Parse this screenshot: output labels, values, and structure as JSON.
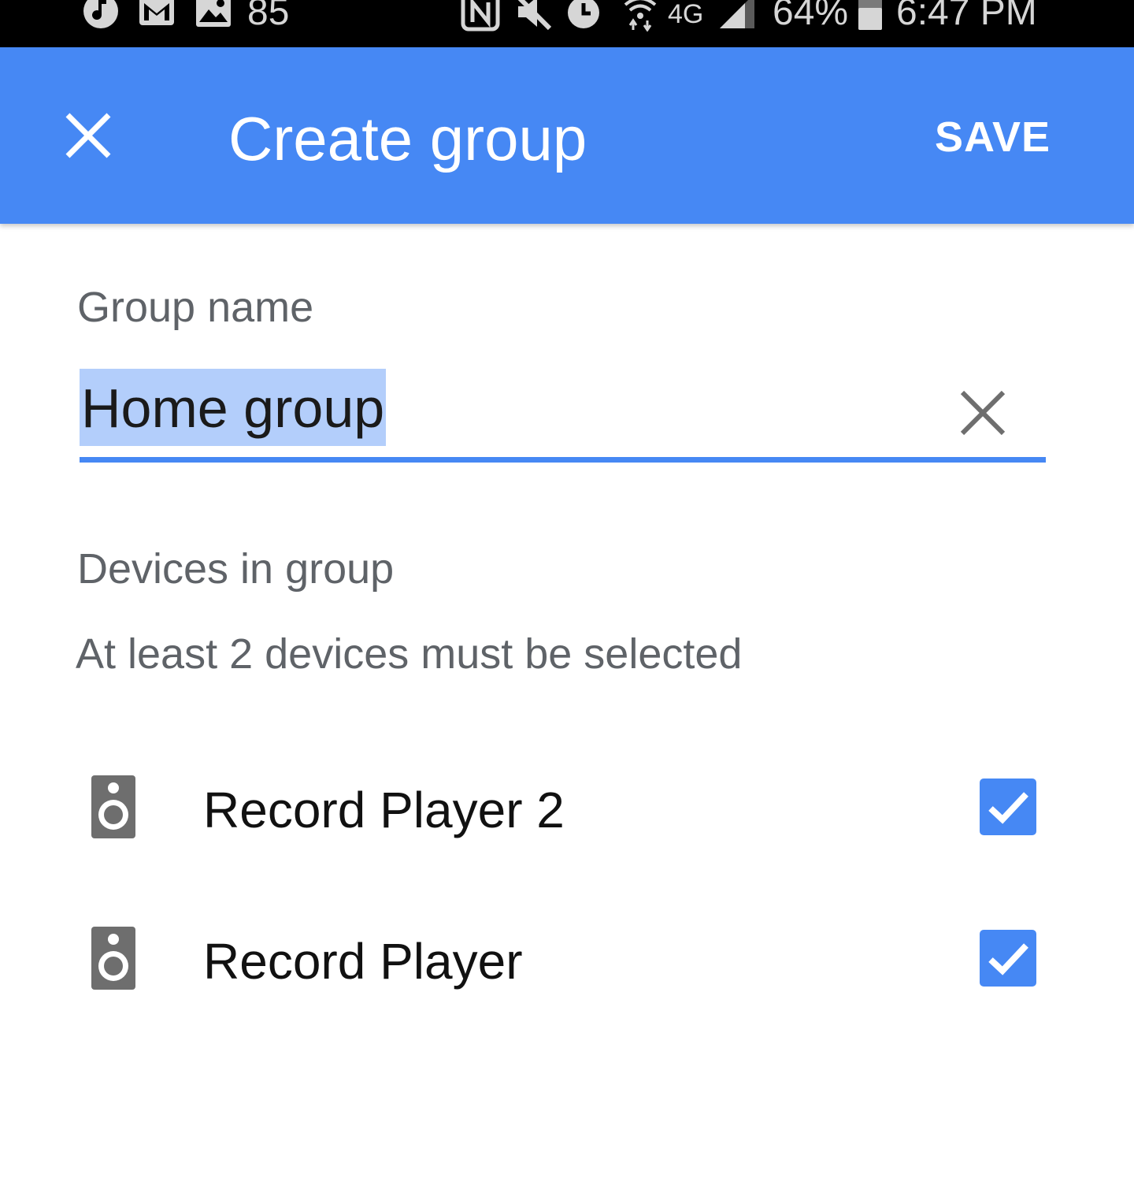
{
  "status_bar": {
    "notification_count": "85",
    "network_label": "4G",
    "battery_percent": "64%",
    "time": "6:47 PM",
    "icons": [
      "music-note-icon",
      "gmail-icon",
      "gallery-icon",
      "nfc-icon",
      "mute-icon",
      "alarm-icon",
      "wifi-icon",
      "signal-icon",
      "battery-icon"
    ]
  },
  "app_bar": {
    "title": "Create group",
    "save_label": "SAVE",
    "background": "#4688f4"
  },
  "form": {
    "group_name_label": "Group name",
    "group_name_value": "Home group",
    "devices_label": "Devices in group",
    "hint": "At least 2 devices must be selected"
  },
  "devices": [
    {
      "name": "Record Player 2",
      "checked": true
    },
    {
      "name": "Record Player",
      "checked": true
    }
  ],
  "colors": {
    "accent": "#4688f4",
    "selection": "#b3cefb",
    "secondary_text": "#5f6368"
  }
}
